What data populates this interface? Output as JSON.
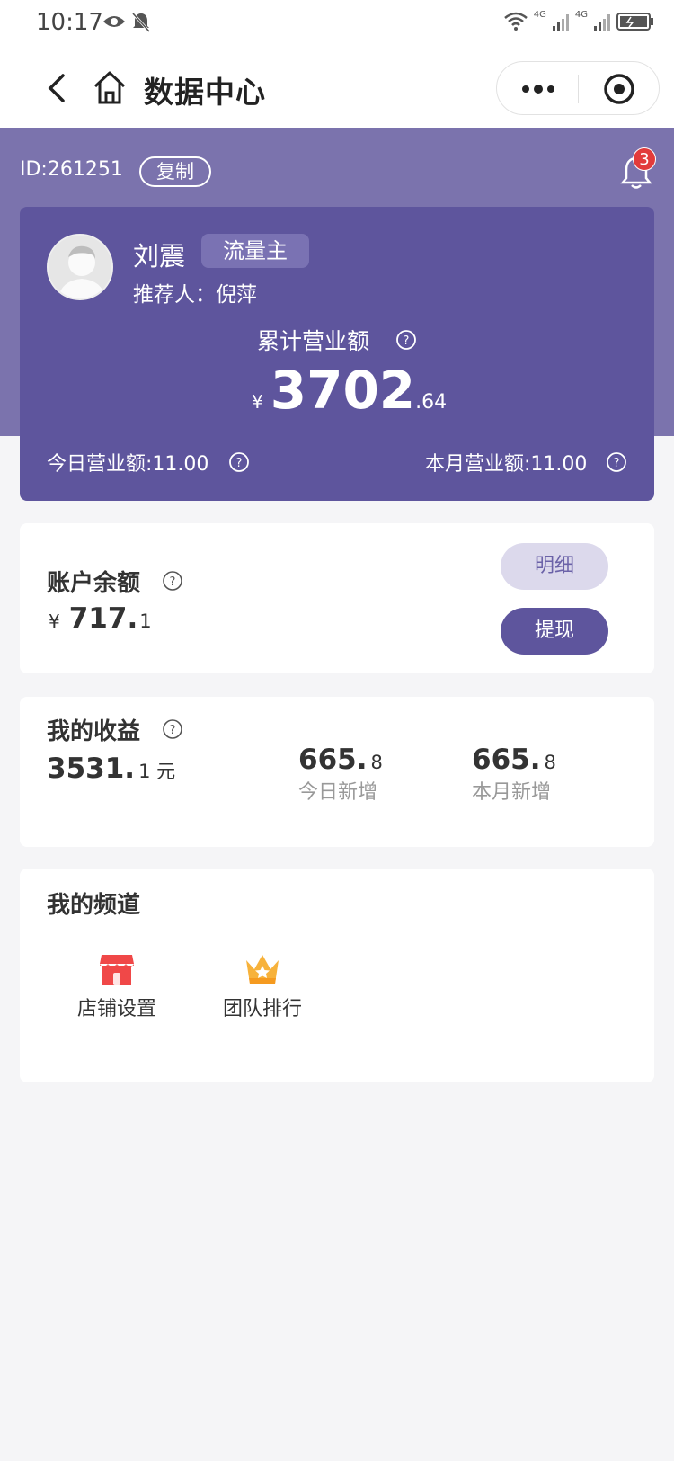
{
  "status_bar": {
    "time": "10:17",
    "network_1": "4G",
    "network_2": "4G"
  },
  "nav": {
    "title": "数据中心"
  },
  "header": {
    "user_id": "ID:261251",
    "copy_label": "复制",
    "notification_count": "3"
  },
  "profile": {
    "name": "刘震",
    "role": "流量主",
    "referrer": "推荐人：倪萍"
  },
  "revenue": {
    "total_label": "累计营业额",
    "currency": "¥",
    "total_int": "3702",
    "total_dec": ".64",
    "today": "今日营业额:11.00",
    "month": "本月营业额:11.00"
  },
  "balance": {
    "title": "账户余额",
    "currency": "¥",
    "amount_int": "717.",
    "amount_dec": "1",
    "detail_label": "明细",
    "withdraw_label": "提现"
  },
  "earnings": {
    "title": "我的收益",
    "total_int": "3531.",
    "total_dec": "1 元",
    "today_int": "665.",
    "today_dec": "8",
    "today_label": "今日新增",
    "month_int": "665.",
    "month_dec": "8",
    "month_label": "本月新增"
  },
  "channels": {
    "title": "我的频道",
    "items": [
      {
        "label": "店铺设置",
        "icon": "shop-icon"
      },
      {
        "label": "团队排行",
        "icon": "crown-icon"
      }
    ]
  },
  "colors": {
    "header_band": "#7b73ad",
    "card_purple": "#5e559d",
    "badge_red": "#e23b3b"
  }
}
